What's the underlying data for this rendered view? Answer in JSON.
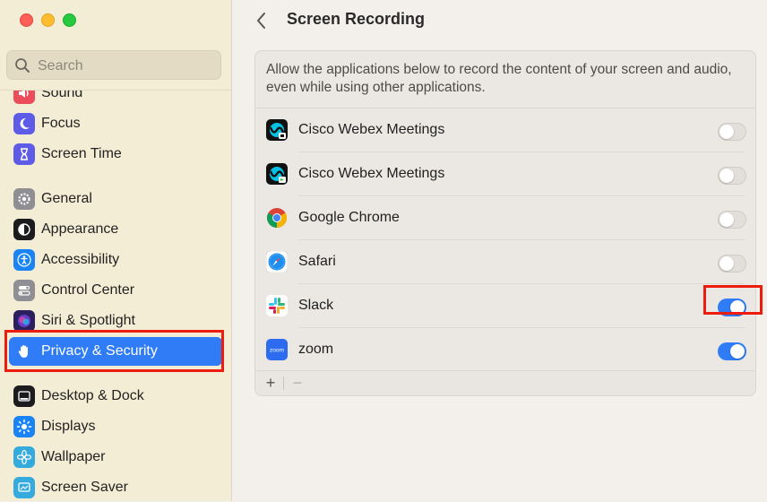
{
  "window": {
    "title": "Screen Recording"
  },
  "search": {
    "placeholder": "Search",
    "value": ""
  },
  "sidebar": {
    "items": [
      {
        "label": "Sound",
        "icon": "speaker-icon",
        "color": "#ec4d5a"
      },
      {
        "label": "Focus",
        "icon": "moon-icon",
        "color": "#5e5ce6"
      },
      {
        "label": "Screen Time",
        "icon": "hourglass-icon",
        "color": "#5e5ce6"
      },
      {
        "label": "General",
        "icon": "gear-icon",
        "color": "#8e8e93"
      },
      {
        "label": "Appearance",
        "icon": "appearance-icon",
        "color": "#1c1c1e"
      },
      {
        "label": "Accessibility",
        "icon": "accessibility-icon",
        "color": "#1a84f5"
      },
      {
        "label": "Control Center",
        "icon": "control-center-icon",
        "color": "#8e8e93"
      },
      {
        "label": "Siri & Spotlight",
        "icon": "siri-icon",
        "color": "#3a2b7e"
      },
      {
        "label": "Privacy & Security",
        "icon": "hand-icon",
        "color": "#2f7cf6",
        "selected": true
      },
      {
        "label": "Desktop & Dock",
        "icon": "dock-icon",
        "color": "#1c1c1e"
      },
      {
        "label": "Displays",
        "icon": "sun-icon",
        "color": "#1a84f5"
      },
      {
        "label": "Wallpaper",
        "icon": "flower-icon",
        "color": "#35aadc"
      },
      {
        "label": "Screen Saver",
        "icon": "screen-saver-icon",
        "color": "#35aadc"
      }
    ]
  },
  "main": {
    "description": "Allow the applications below to record the content of your screen and audio, even while using other applications.",
    "apps": [
      {
        "name": "Cisco Webex Meetings",
        "icon": "webex-icon",
        "enabled": false
      },
      {
        "name": "Cisco Webex Meetings",
        "icon": "webex-icon",
        "enabled": false
      },
      {
        "name": "Google Chrome",
        "icon": "chrome-icon",
        "enabled": false
      },
      {
        "name": "Safari",
        "icon": "safari-icon",
        "enabled": false
      },
      {
        "name": "Slack",
        "icon": "slack-icon",
        "enabled": true
      },
      {
        "name": "zoom",
        "icon": "zoom-icon",
        "enabled": true,
        "icon_text": "zoom"
      }
    ],
    "add_label": "+",
    "remove_label": "−"
  },
  "colors": {
    "accent": "#2f7cf6",
    "highlight": "#ee1c0f",
    "sidebar_bg": "#f4edd5"
  }
}
